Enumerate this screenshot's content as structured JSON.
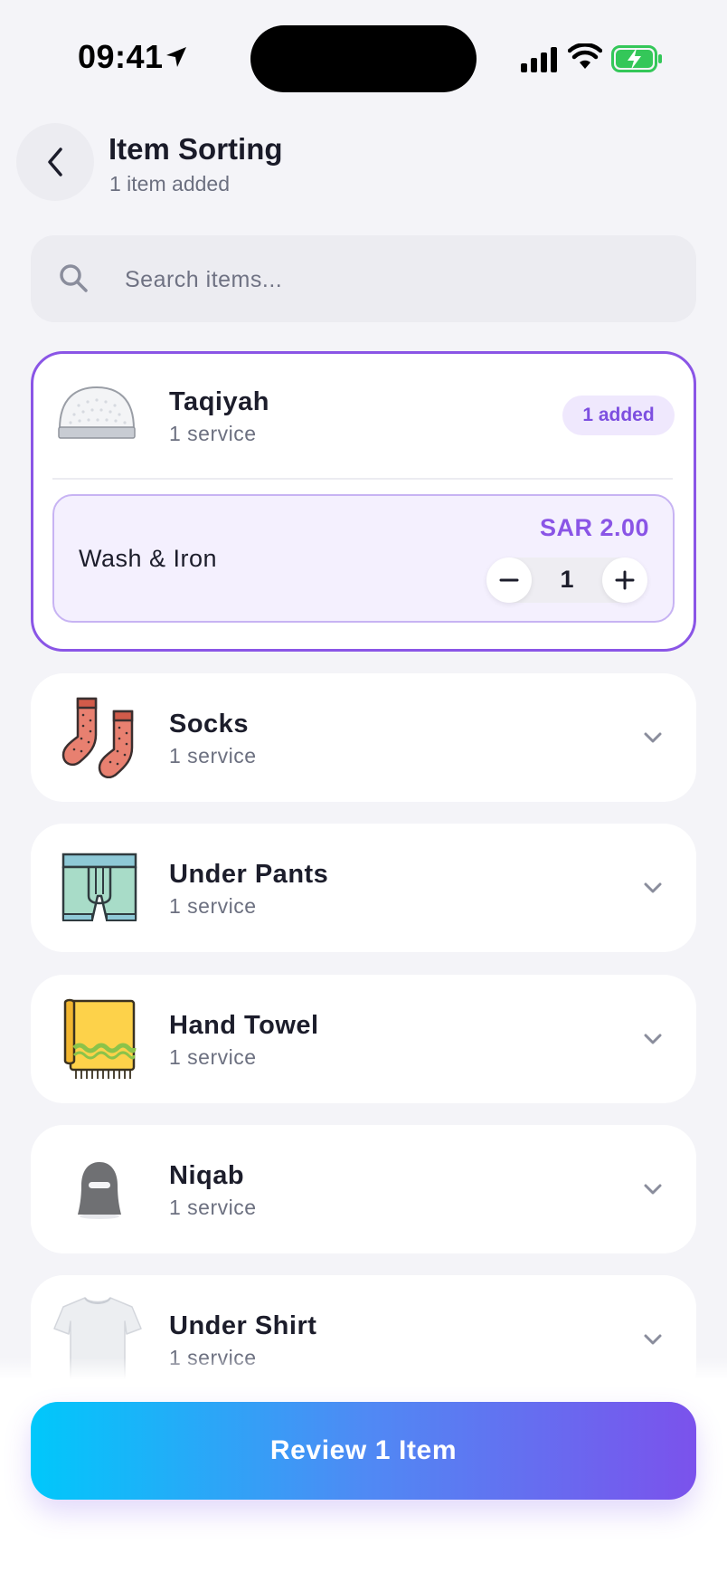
{
  "status_bar": {
    "time": "09:41"
  },
  "header": {
    "title": "Item Sorting",
    "subtitle": "1 item added",
    "back_icon": "chevron-left-icon"
  },
  "search": {
    "placeholder": "Search items...",
    "value": "",
    "icon": "search-icon"
  },
  "expanded_item": {
    "name": "Taqiyah",
    "services_count": "1 service",
    "badge": "1 added",
    "service": {
      "name": "Wash & Iron",
      "price": "SAR 2.00",
      "quantity": "1"
    }
  },
  "items": [
    {
      "name": "Socks",
      "services_count": "1 service",
      "image": "socks-image"
    },
    {
      "name": "Under Pants",
      "services_count": "1 service",
      "image": "under-pants-image"
    },
    {
      "name": "Hand Towel",
      "services_count": "1 service",
      "image": "hand-towel-image"
    },
    {
      "name": "Niqab",
      "services_count": "1 service",
      "image": "niqab-image"
    },
    {
      "name": "Under Shirt",
      "services_count": "1 service",
      "image": "under-shirt-image"
    }
  ],
  "review_button": {
    "label": "Review 1 Item"
  },
  "colors": {
    "accent": "#8a55e6",
    "gradient_start": "#00c8fb",
    "gradient_end": "#7b52ec",
    "background": "#f4f4f8"
  }
}
